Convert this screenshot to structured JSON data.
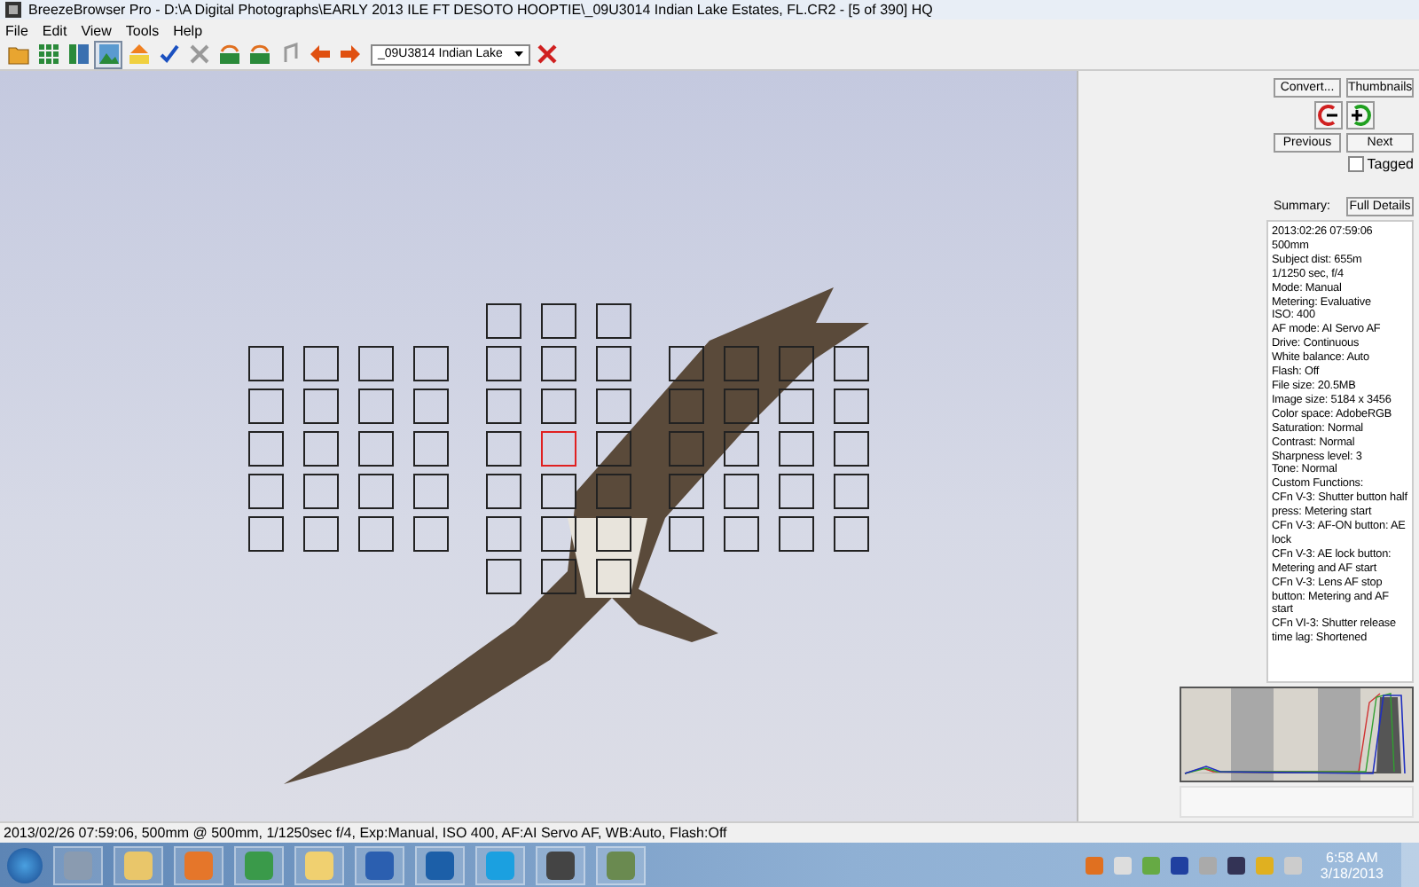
{
  "window": {
    "title": "BreezeBrowser Pro - D:\\A Digital Photographs\\EARLY 2013 ILE FT DESOTO HOOPTIE\\_09U3014  Indian Lake Estates, FL.CR2 - [5 of 390] HQ"
  },
  "menu": [
    "File",
    "Edit",
    "View",
    "Tools",
    "Help"
  ],
  "toolbar": {
    "file_dropdown": "_09U3814  Indian Lake"
  },
  "af_grid": {
    "left": [
      [
        {
          "selected": false
        },
        {
          "selected": false
        },
        {
          "selected": false
        },
        {
          "selected": false
        }
      ],
      [
        {
          "selected": false
        },
        {
          "selected": false
        },
        {
          "selected": false
        },
        {
          "selected": false
        }
      ],
      [
        {
          "selected": false
        },
        {
          "selected": false
        },
        {
          "selected": false
        },
        {
          "selected": false
        }
      ],
      [
        {
          "selected": false
        },
        {
          "selected": false
        },
        {
          "selected": false
        },
        {
          "selected": false
        }
      ],
      [
        {
          "selected": false
        },
        {
          "selected": false
        },
        {
          "selected": false
        },
        {
          "selected": false
        }
      ]
    ],
    "center": [
      [
        {
          "selected": false
        },
        {
          "selected": false
        },
        {
          "selected": false
        }
      ],
      [
        {
          "selected": false
        },
        {
          "selected": false
        },
        {
          "selected": false
        }
      ],
      [
        {
          "selected": false
        },
        {
          "selected": false
        },
        {
          "selected": false
        }
      ],
      [
        {
          "selected": false
        },
        {
          "selected": true
        },
        {
          "selected": false
        }
      ],
      [
        {
          "selected": false
        },
        {
          "selected": false
        },
        {
          "selected": false
        }
      ],
      [
        {
          "selected": false
        },
        {
          "selected": false
        },
        {
          "selected": false
        }
      ],
      [
        {
          "selected": false
        },
        {
          "selected": false
        },
        {
          "selected": false
        }
      ]
    ],
    "right": [
      [
        {
          "selected": false
        },
        {
          "selected": false
        },
        {
          "selected": false
        },
        {
          "selected": false
        }
      ],
      [
        {
          "selected": false
        },
        {
          "selected": false
        },
        {
          "selected": false
        },
        {
          "selected": false
        }
      ],
      [
        {
          "selected": false
        },
        {
          "selected": false
        },
        {
          "selected": false
        },
        {
          "selected": false
        }
      ],
      [
        {
          "selected": false
        },
        {
          "selected": false
        },
        {
          "selected": false
        },
        {
          "selected": false
        }
      ],
      [
        {
          "selected": false
        },
        {
          "selected": false
        },
        {
          "selected": false
        },
        {
          "selected": false
        }
      ]
    ]
  },
  "panel": {
    "convert_button": "Convert...",
    "thumbnails_button": "Thumbnails",
    "previous_button": "Previous",
    "next_button": "Next",
    "tagged": {
      "label": "Tagged",
      "checked": false
    },
    "summary_label": "Summary:",
    "full_details_button": "Full Details",
    "details": [
      "2013:02:26 07:59:06",
      "500mm",
      "Subject dist: 655m",
      "1/1250 sec, f/4",
      "Mode: Manual",
      "Metering: Evaluative",
      "ISO: 400",
      "AF mode: AI Servo AF",
      "Drive: Continuous",
      "White balance: Auto",
      "Flash: Off",
      "File size: 20.5MB",
      "Image size: 5184 x 3456",
      "Color space: AdobeRGB",
      "Saturation: Normal",
      "Contrast: Normal",
      "Sharpness level: 3",
      "Tone: Normal",
      "Custom Functions:",
      "CFn V-3: Shutter button half press: Metering start",
      "CFn V-3: AF-ON button: AE lock",
      "CFn V-3: AE lock button: Metering and AF start",
      "CFn V-3: Lens AF stop button: Metering and AF start",
      "CFn VI-3: Shutter release time lag: Shortened"
    ]
  },
  "status_bar": "2013/02/26 07:59:06, 500mm @ 500mm, 1/1250sec f/4, Exp:Manual, ISO 400, AF:AI Servo AF, WB:Auto, Flash:Off",
  "taskbar": {
    "time": "6:58 AM",
    "date": "3/18/2013"
  }
}
